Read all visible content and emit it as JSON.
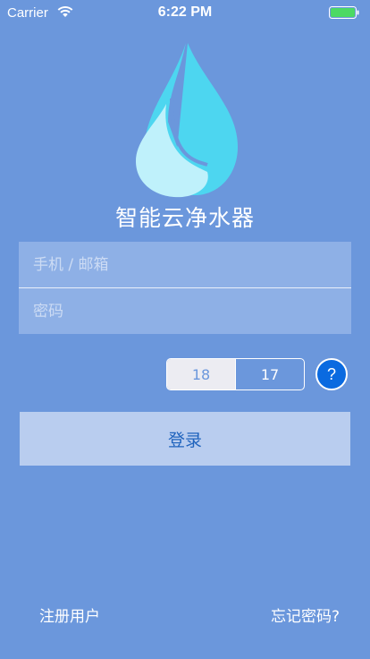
{
  "status_bar": {
    "carrier": "Carrier",
    "time": "6:22 PM",
    "battery_color": "#4cd964"
  },
  "app": {
    "title": "智能云净水器",
    "logo_colors": {
      "light": "#bff1fb",
      "dark": "#4dd6f0"
    }
  },
  "form": {
    "account_placeholder": "手机 / 邮箱",
    "password_placeholder": "密码"
  },
  "segmented": {
    "options": [
      "18",
      "17"
    ],
    "selected": "18"
  },
  "help": {
    "label": "?"
  },
  "login": {
    "label": "登录"
  },
  "links": {
    "register": "注册用户",
    "forgot": "忘记密码?"
  },
  "colors": {
    "background": "#6b97dc",
    "accent": "#0a6ae0",
    "button_text": "#1f63bd"
  }
}
